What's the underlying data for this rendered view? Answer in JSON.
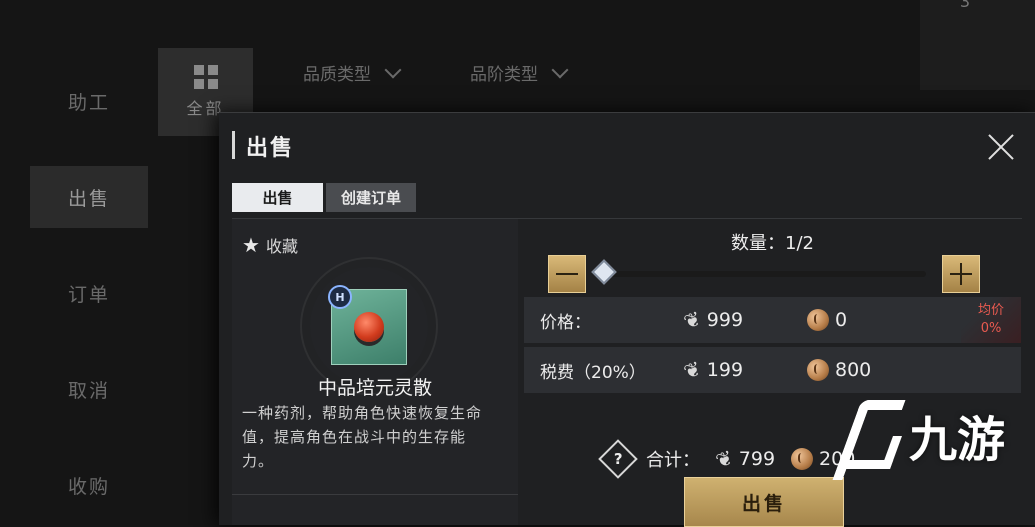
{
  "background": {
    "nav_items": [
      "助工",
      "出售",
      "订单",
      "取消",
      "收购"
    ],
    "category_all_label": "全部",
    "filters": [
      "品质类型",
      "品阶类型"
    ],
    "top_right_number": "3"
  },
  "modal": {
    "title": "出售",
    "tabs": [
      {
        "label": "出售",
        "active": true
      },
      {
        "label": "创建订单",
        "active": false
      }
    ],
    "item": {
      "favorite_label": "收藏",
      "grade_badge": "H",
      "name": "中品培元灵散",
      "description": "一种药剂，帮助角色快速恢复生命值，提高角色在战斗中的生存能力。"
    },
    "quantity": {
      "label": "数量：1/2",
      "current": 1,
      "max": 2
    },
    "price_row": {
      "label": "价格：",
      "value_a": "999",
      "value_b": "0",
      "avg_label": "均价",
      "avg_value": "0%"
    },
    "tax_row": {
      "label": "税费（20%）",
      "value_a": "199",
      "value_b": "800"
    },
    "total": {
      "label": "合计：",
      "value_a": "799",
      "value_b": "200"
    },
    "sell_button": "出售"
  },
  "watermark": {
    "text": "九游"
  },
  "colors": {
    "accent_gold": "#c9a96a",
    "warning_red": "#e85a50",
    "tab_active": "#e9ebee"
  }
}
